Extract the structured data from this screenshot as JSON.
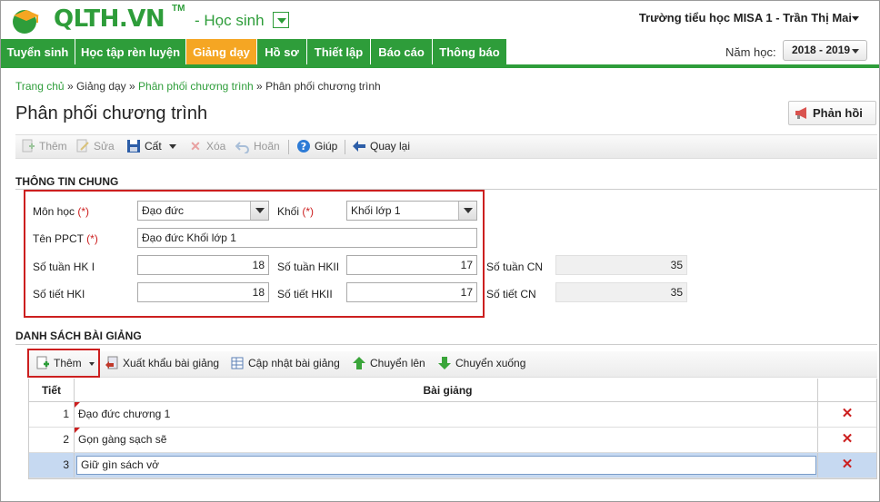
{
  "header": {
    "logo_text": "QLTH.VN",
    "logo_tm": "TM",
    "role": "- Học sinh",
    "user": "Trường tiểu học MISA 1 - Trần Thị Mai"
  },
  "nav": {
    "items": [
      "Tuyển sinh",
      "Học tập rèn luyện",
      "Giảng dạy",
      "Hồ sơ",
      "Thiết lập",
      "Báo cáo",
      "Thông báo"
    ],
    "active": "Giảng dạy",
    "year_label": "Năm học:",
    "year_value": "2018 - 2019"
  },
  "breadcrumb": {
    "home": "Trang chủ",
    "sep": "»",
    "l1": "Giảng dạy",
    "l2": "Phân phối chương trình",
    "current": "Phân phối chương trình"
  },
  "page": {
    "title": "Phân phối chương trình",
    "feedback": "Phản hồi"
  },
  "toolbar": {
    "add": "Thêm",
    "edit": "Sửa",
    "save": "Cất",
    "delete": "Xóa",
    "undo": "Hoãn",
    "help": "Giúp",
    "back": "Quay lại"
  },
  "general": {
    "heading": "THÔNG TIN CHUNG",
    "subject_label": "Môn học",
    "subject_value": "Đạo đức",
    "grade_label": "Khối",
    "grade_value": "Khối lớp 1",
    "required_mark": "(*)",
    "name_label": "Tên PPCT",
    "name_value": "Đạo đức Khối lớp 1",
    "weeks_hk1_label": "Số tuần HK I",
    "weeks_hk1": "18",
    "weeks_hk2_label": "Số tuần HKII",
    "weeks_hk2": "17",
    "weeks_cn_label": "Số tuần CN",
    "weeks_cn": "35",
    "periods_hk1_label": "Số tiết HKI",
    "periods_hk1": "18",
    "periods_hk2_label": "Số tiết HKII",
    "periods_hk2": "17",
    "periods_cn_label": "Số tiết CN",
    "periods_cn": "35"
  },
  "lessons": {
    "heading": "DANH SÁCH BÀI GIẢNG",
    "add": "Thêm",
    "export": "Xuất khẩu bài giảng",
    "update": "Cập nhật bài giảng",
    "move_up": "Chuyển lên",
    "move_down": "Chuyển xuống",
    "col_period": "Tiết",
    "col_lesson": "Bài giảng",
    "rows": [
      {
        "period": "1",
        "lesson": "Đạo đức chương 1"
      },
      {
        "period": "2",
        "lesson": "Gọn gàng sạch sẽ"
      },
      {
        "period": "3",
        "lesson": "Giữ gìn sách vở"
      }
    ]
  },
  "colors": {
    "brand_green": "#2e9d3a",
    "active_tab": "#f5a623",
    "highlight_red": "#cc1f1f",
    "selected_row": "#c6d9f1"
  }
}
